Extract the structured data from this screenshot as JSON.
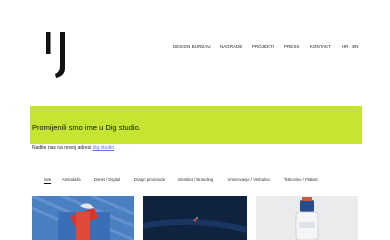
{
  "brand": {
    "logo_alt": "IJ"
  },
  "nav": {
    "items": [
      "DESIGN BUREAU",
      "NAGRADE",
      "PROJEKTI",
      "PRESS",
      "KONTAKT"
    ],
    "languages": [
      "HR",
      "EN"
    ]
  },
  "banner": {
    "headline": "Promijenili smo ime u Dig studio.",
    "subtext": "Nađite nas na novoj adresi",
    "link_label": "dig studio"
  },
  "filters": [
    {
      "label": "Sve",
      "active": true
    },
    {
      "label": "Ambalaža",
      "active": false
    },
    {
      "label": "Direkt / Digital",
      "active": false
    },
    {
      "label": "Dizajn proizvoda",
      "active": false
    },
    {
      "label": "Identitet / Branding",
      "active": false
    },
    {
      "label": "Imenovanje / Verbalna",
      "active": false
    },
    {
      "label": "Tiskovine / Plakati",
      "active": false
    }
  ],
  "colors": {
    "banner": "#c6e533",
    "link": "#5a7de0",
    "text": "#1a1a1a"
  }
}
